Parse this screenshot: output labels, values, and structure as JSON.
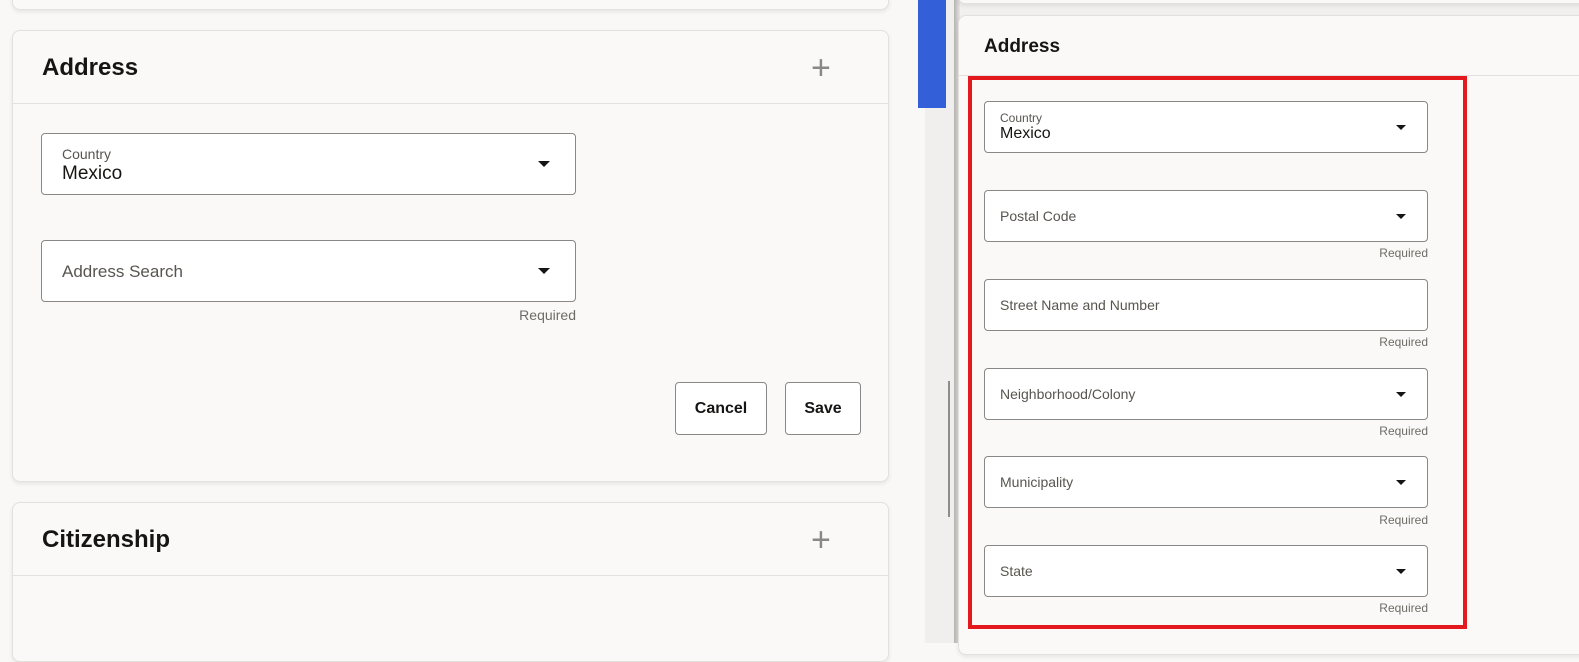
{
  "left": {
    "address": {
      "title": "Address",
      "country_label": "Country",
      "country_value": "Mexico",
      "search_placeholder": "Address Search",
      "required": "Required",
      "cancel": "Cancel",
      "save": "Save"
    },
    "citizenship": {
      "title": "Citizenship"
    }
  },
  "right": {
    "address": {
      "title": "Address",
      "country_label": "Country",
      "country_value": "Mexico",
      "fields": [
        {
          "label": "Postal Code",
          "required": "Required"
        },
        {
          "label": "Street Name and Number",
          "required": "Required"
        },
        {
          "label": "Neighborhood/Colony",
          "required": "Required"
        },
        {
          "label": "Municipality",
          "required": "Required"
        },
        {
          "label": "State",
          "required": "Required"
        }
      ]
    }
  },
  "colors": {
    "accent_blue": "#335fd9",
    "highlight_red": "#e3191d"
  }
}
